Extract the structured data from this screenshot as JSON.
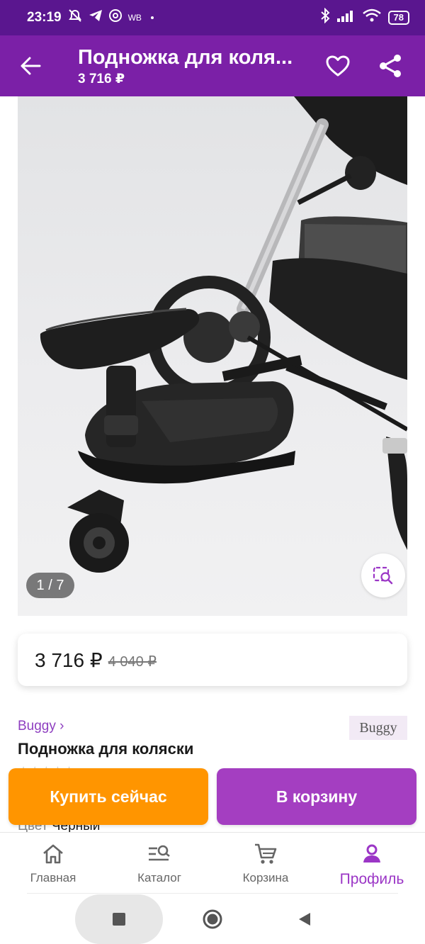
{
  "status_bar": {
    "time": "23:19",
    "carrier_tag": "WB",
    "battery": "78"
  },
  "app_bar": {
    "title": "Подножка для коля...",
    "price": "3 716 ₽"
  },
  "gallery": {
    "counter": "1 / 7"
  },
  "price_card": {
    "current": "3 716 ₽",
    "old": "4 040 ₽"
  },
  "product": {
    "brand_link": "Buggy ›",
    "brand_logo": "Buggy",
    "name": "Подножка для коляски",
    "rating_stars": "★★★★★",
    "color_label": "Цвет",
    "color_value": "Черный"
  },
  "actions": {
    "buy_now": "Купить сейчас",
    "add_to_cart": "В корзину"
  },
  "bottom_nav": {
    "items": [
      {
        "label": "Главная",
        "icon": "home-icon"
      },
      {
        "label": "Каталог",
        "icon": "catalog-search-icon"
      },
      {
        "label": "Корзина",
        "icon": "cart-icon"
      },
      {
        "label": "Профиль",
        "icon": "profile-icon"
      }
    ],
    "active_index": 3
  },
  "colors": {
    "status_bar": "#5a168f",
    "app_bar": "#7b20a7",
    "buy_button": "#ff9500",
    "cart_button": "#a43ec1",
    "active_nav": "#9b36c6",
    "brand_link": "#8e3fc0"
  }
}
